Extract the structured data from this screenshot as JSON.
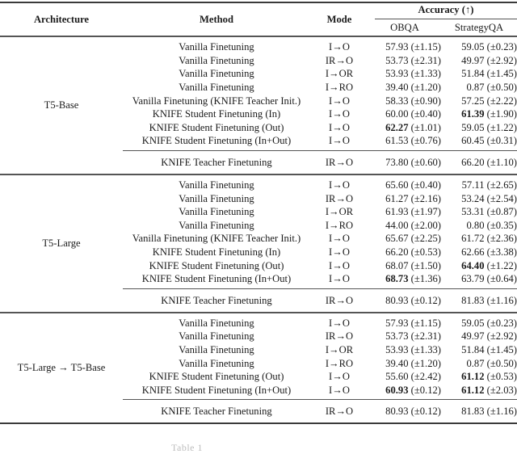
{
  "header": {
    "architecture": "Architecture",
    "method": "Method",
    "mode": "Mode",
    "accuracy": "Accuracy (↑)",
    "obqa": "OBQA",
    "strategyqa": "StrategyQA"
  },
  "groups": [
    {
      "architecture": "T5-Base",
      "rows": [
        {
          "method": "Vanilla Finetuning",
          "mode": "I→O",
          "obqa_value": "57.93",
          "obqa_std": " (±1.15)",
          "obqa_bold": false,
          "sqa_value": "59.05",
          "sqa_std": " (±0.23)",
          "sqa_bold": false
        },
        {
          "method": "Vanilla Finetuning",
          "mode": "IR→O",
          "obqa_value": "53.73",
          "obqa_std": " (±2.31)",
          "obqa_bold": false,
          "sqa_value": "49.97",
          "sqa_std": " (±2.92)",
          "sqa_bold": false
        },
        {
          "method": "Vanilla Finetuning",
          "mode": "I→OR",
          "obqa_value": "53.93",
          "obqa_std": " (±1.33)",
          "obqa_bold": false,
          "sqa_value": "51.84",
          "sqa_std": " (±1.45)",
          "sqa_bold": false
        },
        {
          "method": "Vanilla Finetuning",
          "mode": "I→RO",
          "obqa_value": "39.40",
          "obqa_std": " (±1.20)",
          "obqa_bold": false,
          "sqa_value": "0.87",
          "sqa_std": " (±0.50)",
          "sqa_bold": false
        },
        {
          "method": "Vanilla Finetuning (KNIFE Teacher Init.)",
          "mode": "I→O",
          "obqa_value": "58.33",
          "obqa_std": " (±0.90)",
          "obqa_bold": false,
          "sqa_value": "57.25",
          "sqa_std": " (±2.22)",
          "sqa_bold": false
        },
        {
          "method": "KNIFE Student Finetuning (In)",
          "mode": "I→O",
          "obqa_value": "60.00",
          "obqa_std": " (±0.40)",
          "obqa_bold": false,
          "sqa_value": "61.39",
          "sqa_std": " (±1.90)",
          "sqa_bold": true
        },
        {
          "method": "KNIFE Student Finetuning (Out)",
          "mode": "I→O",
          "obqa_value": "62.27",
          "obqa_std": " (±1.01)",
          "obqa_bold": true,
          "sqa_value": "59.05",
          "sqa_std": " (±1.22)",
          "sqa_bold": false
        },
        {
          "method": "KNIFE Student Finetuning (In+Out)",
          "mode": "I→O",
          "obqa_value": "61.53",
          "obqa_std": " (±0.76)",
          "obqa_bold": false,
          "sqa_value": "60.45",
          "sqa_std": " (±0.31)",
          "sqa_bold": false
        }
      ],
      "teacher": {
        "method": "KNIFE Teacher Finetuning",
        "mode": "IR→O",
        "obqa_value": "73.80",
        "obqa_std": " (±0.60)",
        "sqa_value": "66.20",
        "sqa_std": " (±1.10)"
      }
    },
    {
      "architecture": "T5-Large",
      "rows": [
        {
          "method": "Vanilla Finetuning",
          "mode": "I→O",
          "obqa_value": "65.60",
          "obqa_std": " (±0.40)",
          "obqa_bold": false,
          "sqa_value": "57.11",
          "sqa_std": " (±2.65)",
          "sqa_bold": false
        },
        {
          "method": "Vanilla Finetuning",
          "mode": "IR→O",
          "obqa_value": "61.27",
          "obqa_std": " (±2.16)",
          "obqa_bold": false,
          "sqa_value": "53.24",
          "sqa_std": " (±2.54)",
          "sqa_bold": false
        },
        {
          "method": "Vanilla Finetuning",
          "mode": "I→OR",
          "obqa_value": "61.93",
          "obqa_std": " (±1.97)",
          "obqa_bold": false,
          "sqa_value": "53.31",
          "sqa_std": " (±0.87)",
          "sqa_bold": false
        },
        {
          "method": "Vanilla Finetuning",
          "mode": "I→RO",
          "obqa_value": "44.00",
          "obqa_std": " (±2.00)",
          "obqa_bold": false,
          "sqa_value": "0.80",
          "sqa_std": " (±0.35)",
          "sqa_bold": false
        },
        {
          "method": "Vanilla Finetuning (KNIFE Teacher Init.)",
          "mode": "I→O",
          "obqa_value": "65.67",
          "obqa_std": " (±2.25)",
          "obqa_bold": false,
          "sqa_value": "61.72",
          "sqa_std": " (±2.36)",
          "sqa_bold": false
        },
        {
          "method": "KNIFE Student Finetuning (In)",
          "mode": "I→O",
          "obqa_value": "66.20",
          "obqa_std": " (±0.53)",
          "obqa_bold": false,
          "sqa_value": "62.66",
          "sqa_std": " (±3.38)",
          "sqa_bold": false
        },
        {
          "method": "KNIFE Student Finetuning (Out)",
          "mode": "I→O",
          "obqa_value": "68.07",
          "obqa_std": " (±1.50)",
          "obqa_bold": false,
          "sqa_value": "64.40",
          "sqa_std": " (±1.22)",
          "sqa_bold": true
        },
        {
          "method": "KNIFE Student Finetuning (In+Out)",
          "mode": "I→O",
          "obqa_value": "68.73",
          "obqa_std": " (±1.36)",
          "obqa_bold": true,
          "sqa_value": "63.79",
          "sqa_std": " (±0.64)",
          "sqa_bold": false
        }
      ],
      "teacher": {
        "method": "KNIFE Teacher Finetuning",
        "mode": "IR→O",
        "obqa_value": "80.93",
        "obqa_std": " (±0.12)",
        "sqa_value": "81.83",
        "sqa_std": " (±1.16)"
      }
    },
    {
      "architecture": "T5-Large → T5-Base",
      "rows": [
        {
          "method": "Vanilla Finetuning",
          "mode": "I→O",
          "obqa_value": "57.93",
          "obqa_std": " (±1.15)",
          "obqa_bold": false,
          "sqa_value": "59.05",
          "sqa_std": " (±0.23)",
          "sqa_bold": false
        },
        {
          "method": "Vanilla Finetuning",
          "mode": "IR→O",
          "obqa_value": "53.73",
          "obqa_std": " (±2.31)",
          "obqa_bold": false,
          "sqa_value": "49.97",
          "sqa_std": " (±2.92)",
          "sqa_bold": false
        },
        {
          "method": "Vanilla Finetuning",
          "mode": "I→OR",
          "obqa_value": "53.93",
          "obqa_std": " (±1.33)",
          "obqa_bold": false,
          "sqa_value": "51.84",
          "sqa_std": " (±1.45)",
          "sqa_bold": false
        },
        {
          "method": "Vanilla Finetuning",
          "mode": "I→RO",
          "obqa_value": "39.40",
          "obqa_std": " (±1.20)",
          "obqa_bold": false,
          "sqa_value": "0.87",
          "sqa_std": " (±0.50)",
          "sqa_bold": false
        },
        {
          "method": "KNIFE Student Finetuning (Out)",
          "mode": "I→O",
          "obqa_value": "55.60",
          "obqa_std": " (±2.42)",
          "obqa_bold": false,
          "sqa_value": "61.12",
          "sqa_std": " (±0.53)",
          "sqa_bold": true
        },
        {
          "method": "KNIFE Student Finetuning (In+Out)",
          "mode": "I→O",
          "obqa_value": "60.93",
          "obqa_std": " (±0.12)",
          "obqa_bold": true,
          "sqa_value": "61.12",
          "sqa_std": " (±2.03)",
          "sqa_bold": true
        }
      ],
      "teacher": {
        "method": "KNIFE Teacher Finetuning",
        "mode": "IR→O",
        "obqa_value": "80.93",
        "obqa_std": " (±0.12)",
        "sqa_value": "81.83",
        "sqa_std": " (±1.16)"
      }
    }
  ],
  "caption": "Table 1"
}
